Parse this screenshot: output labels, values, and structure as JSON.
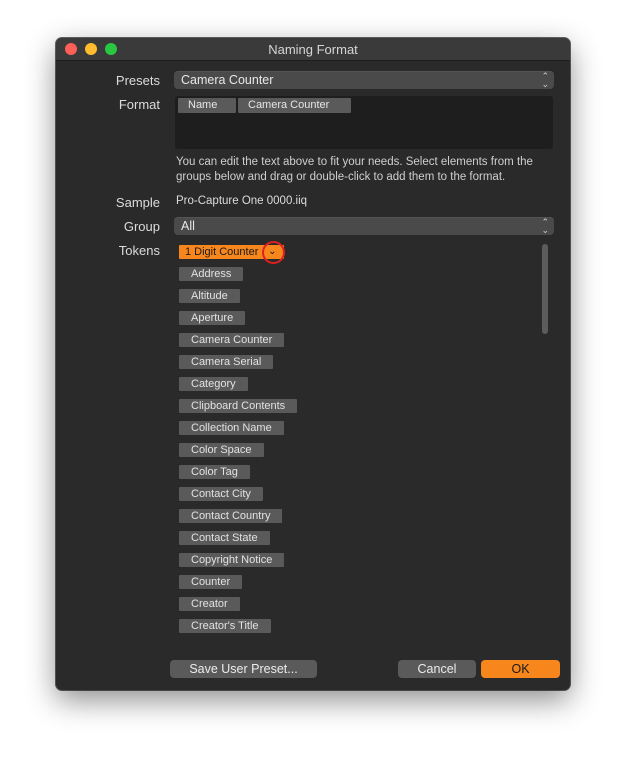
{
  "window": {
    "title": "Naming Format"
  },
  "labels": {
    "presets": "Presets",
    "format": "Format",
    "sample": "Sample",
    "group": "Group",
    "tokens": "Tokens"
  },
  "presets": {
    "value": "Camera Counter"
  },
  "format": {
    "tokens": [
      "Name",
      "Camera Counter"
    ]
  },
  "help_text": "You can edit the text above to fit your needs. Select elements from the groups below and drag or double-click to add them to the format.",
  "sample": {
    "value": "Pro-Capture One 0000.iiq"
  },
  "group": {
    "value": "All"
  },
  "tokens": [
    "1 Digit Counter",
    "Address",
    "Altitude",
    "Aperture",
    "Camera Counter",
    "Camera Serial",
    "Category",
    "Clipboard Contents",
    "Collection Name",
    "Color Space",
    "Color Tag",
    "Contact City",
    "Contact Country",
    "Contact State",
    "Copyright Notice",
    "Counter",
    "Creator",
    "Creator's Title"
  ],
  "buttons": {
    "save": "Save User Preset...",
    "cancel": "Cancel",
    "ok": "OK"
  },
  "colors": {
    "accent": "#f7861c",
    "highlight_ring": "#e02020"
  },
  "icons": {
    "popup_arrows": "updown-chevron-icon",
    "token_menu": "chevron-down-icon"
  }
}
